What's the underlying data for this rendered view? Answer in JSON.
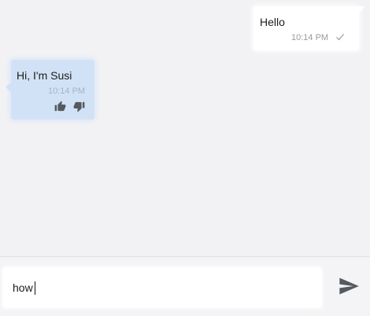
{
  "chat": {
    "messages": [
      {
        "direction": "outgoing",
        "text": "Hello",
        "time": "10:14 PM",
        "status_icon": "check-icon"
      },
      {
        "direction": "incoming",
        "text": "Hi, I'm Susi",
        "time": "10:14 PM",
        "feedback_icons": [
          "thumbs-up-icon",
          "thumbs-down-icon"
        ]
      }
    ]
  },
  "composer": {
    "input_value": "how",
    "send_icon": "send-icon"
  },
  "colors": {
    "background": "#f2f2f5",
    "outgoing_bubble": "#ffffff",
    "incoming_bubble": "#d2e2f6",
    "icon": "#555a60"
  }
}
